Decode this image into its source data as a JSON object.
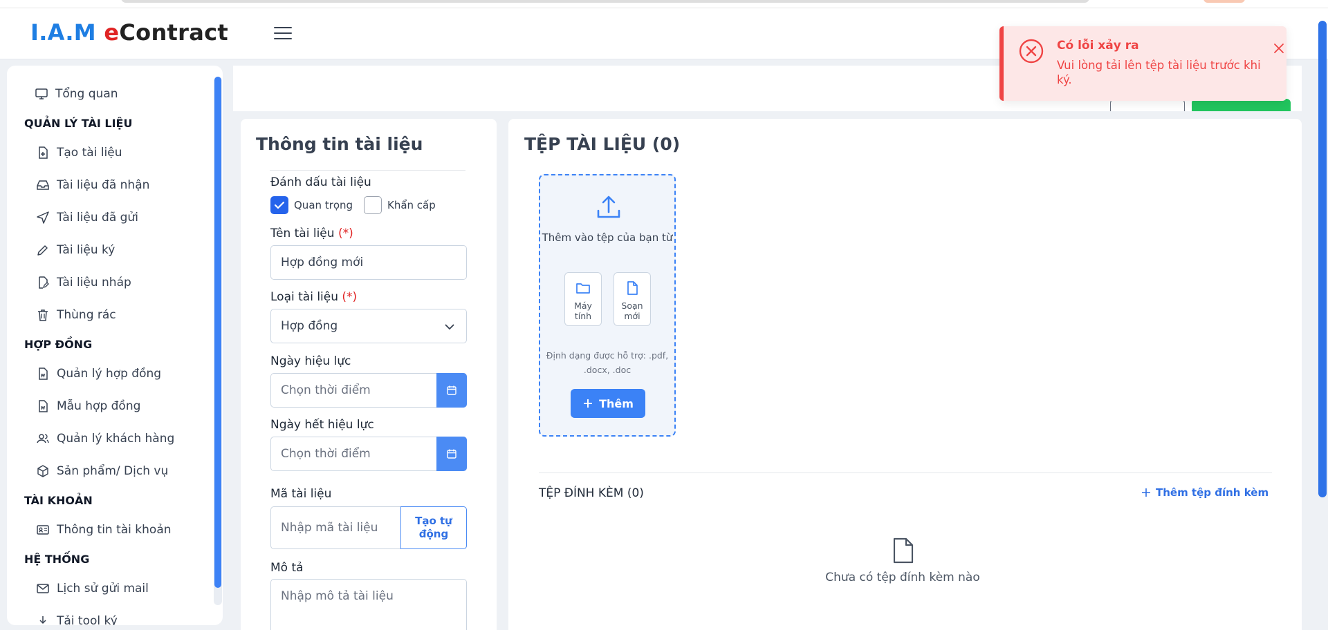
{
  "app": {
    "logo_prefix": "I.A.M",
    "logo_e": "e",
    "logo_rest": "Contract"
  },
  "sidebar": {
    "overview": "Tổng quan",
    "sections": [
      {
        "title": "QUẢN LÝ TÀI LIỆU",
        "items": [
          "Tạo tài liệu",
          "Tài liệu đã nhận",
          "Tài liệu đã gửi",
          "Tài liệu ký",
          "Tài liệu nháp",
          "Thùng rác"
        ]
      },
      {
        "title": "HỢP ĐỒNG",
        "items": [
          "Quản lý hợp đồng",
          "Mẫu hợp đồng",
          "Quản lý khách hàng",
          "Sản phẩm/ Dịch vụ"
        ]
      },
      {
        "title": "TÀI KHOẢN",
        "items": [
          "Thông tin tài khoản"
        ]
      },
      {
        "title": "HỆ THỐNG",
        "items": [
          "Lịch sử gửi mail",
          "Tải tool ký"
        ]
      }
    ]
  },
  "form": {
    "title": "Thông tin tài liệu",
    "mark_label": "Đánh dấu tài liệu",
    "important_label": "Quan trọng",
    "important_checked": true,
    "urgent_label": "Khẩn cấp",
    "urgent_checked": false,
    "name_label": "Tên tài liệu",
    "required_mark": "(*)",
    "name_value": "Hợp đồng mới",
    "type_label": "Loại tài liệu",
    "type_value": "Hợp đồng",
    "effective_label": "Ngày hiệu lực",
    "effective_placeholder": "Chọn thời điểm",
    "expire_label": "Ngày hết hiệu lực",
    "expire_placeholder": "Chọn thời điểm",
    "code_label": "Mã tài liệu",
    "code_placeholder": "Nhập mã tài liệu",
    "code_generate": "Tạo tự động",
    "desc_label": "Mô tả",
    "desc_placeholder": "Nhập mô tả tài liệu"
  },
  "files": {
    "title": "TỆP TÀI LIỆU (0)",
    "add_from": "Thêm vào tệp của bạn từ",
    "computer": "Máy tính",
    "compose": "Soạn mới",
    "formats": "Định dạng được hỗ trợ: .pdf, .docx, .doc",
    "add_button": "Thêm",
    "attachments_title": "TỆP ĐÍNH KÈM (0)",
    "add_attachment": "Thêm tệp đính kèm",
    "empty_attachments": "Chưa có tệp đính kèm nào"
  },
  "toast": {
    "title": "Có lỗi xảy ra",
    "message": "Vui lòng tải lên tệp tài liệu trước khi ký."
  },
  "colors": {
    "accent": "#3b82f6",
    "error": "#ef4444",
    "success": "#22c55e"
  }
}
